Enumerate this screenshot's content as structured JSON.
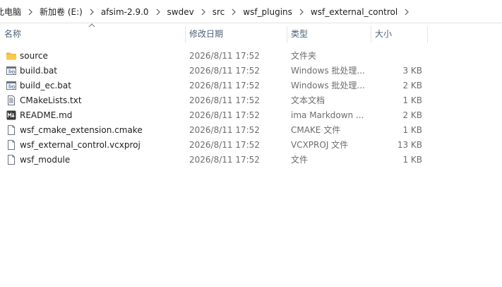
{
  "breadcrumb": {
    "items": [
      {
        "label": "此电脑"
      },
      {
        "label": "新加卷 (E:)"
      },
      {
        "label": "afsim-2.9.0"
      },
      {
        "label": "swdev"
      },
      {
        "label": "src"
      },
      {
        "label": "wsf_plugins"
      },
      {
        "label": "wsf_external_control"
      }
    ]
  },
  "columns": {
    "name": "名称",
    "date": "修改日期",
    "type": "类型",
    "size": "大小",
    "sort_column": "名称",
    "sort_direction": "ascending"
  },
  "files": [
    {
      "name": "source",
      "date": "2026/8/11 17:52",
      "type": "文件夹",
      "size": "",
      "icon": "folder-icon"
    },
    {
      "name": "build.bat",
      "date": "2026/8/11 17:52",
      "type": "Windows 批处理...",
      "size": "3 KB",
      "icon": "batch-file-icon"
    },
    {
      "name": "build_ec.bat",
      "date": "2026/8/11 17:52",
      "type": "Windows 批处理...",
      "size": "2 KB",
      "icon": "batch-file-icon"
    },
    {
      "name": "CMakeLists.txt",
      "date": "2026/8/11 17:52",
      "type": "文本文档",
      "size": "1 KB",
      "icon": "text-file-icon"
    },
    {
      "name": "README.md",
      "date": "2026/8/11 17:52",
      "type": "ima Markdown ...",
      "size": "2 KB",
      "icon": "markdown-file-icon"
    },
    {
      "name": "wsf_cmake_extension.cmake",
      "date": "2026/8/11 17:52",
      "type": "CMAKE 文件",
      "size": "1 KB",
      "icon": "blank-file-icon"
    },
    {
      "name": "wsf_external_control.vcxproj",
      "date": "2026/8/11 17:52",
      "type": "VCXPROJ 文件",
      "size": "13 KB",
      "icon": "blank-file-icon"
    },
    {
      "name": "wsf_module",
      "date": "2026/8/11 17:52",
      "type": "文件",
      "size": "1 KB",
      "icon": "blank-file-icon"
    }
  ],
  "colors": {
    "header_text": "#4c607a",
    "folder": "#f8c84a",
    "text_primary": "#1e1e1e",
    "text_secondary": "#6d6d6d"
  }
}
